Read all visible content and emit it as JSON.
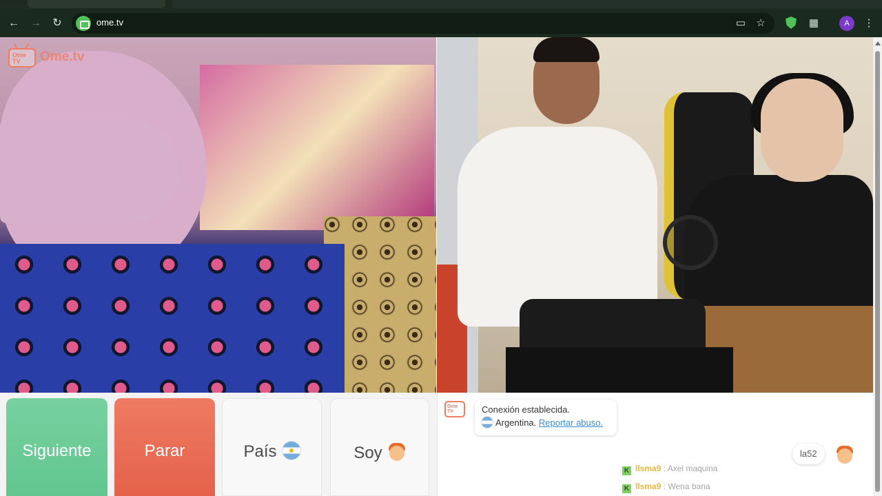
{
  "browser": {
    "url": "ome.tv",
    "profile_initial": "A",
    "icons": [
      "back-icon",
      "forward-icon",
      "reload-icon",
      "install-app-icon",
      "star-icon",
      "shield-icon",
      "extensions-icon",
      "menu-icon"
    ]
  },
  "logo": {
    "badge_text": "Ome TV",
    "wordmark": "Ome.tv"
  },
  "controls": {
    "next_label": "Siguiente",
    "stop_label": "Parar",
    "country_label": "País",
    "gender_label": "Soy"
  },
  "chat": {
    "logo_badge_text": "Ome TV",
    "system": {
      "connected": "Conexión establecida.",
      "country": "Argentina.",
      "report": "Reportar abuso."
    },
    "peer_tag": "la52",
    "messages": [
      {
        "badge": "K",
        "user": "llsma9",
        "sep": " : ",
        "text": "Axel maquina"
      },
      {
        "badge": "K",
        "user": "llsma9",
        "sep": " : ",
        "text": "Wena bana"
      }
    ]
  },
  "colors": {
    "next": "#62c68f",
    "stop": "#e4624a",
    "brand": "#f07d62",
    "link": "#3a8dd6",
    "nick": "#e3a000",
    "kick": "#53c32a"
  }
}
